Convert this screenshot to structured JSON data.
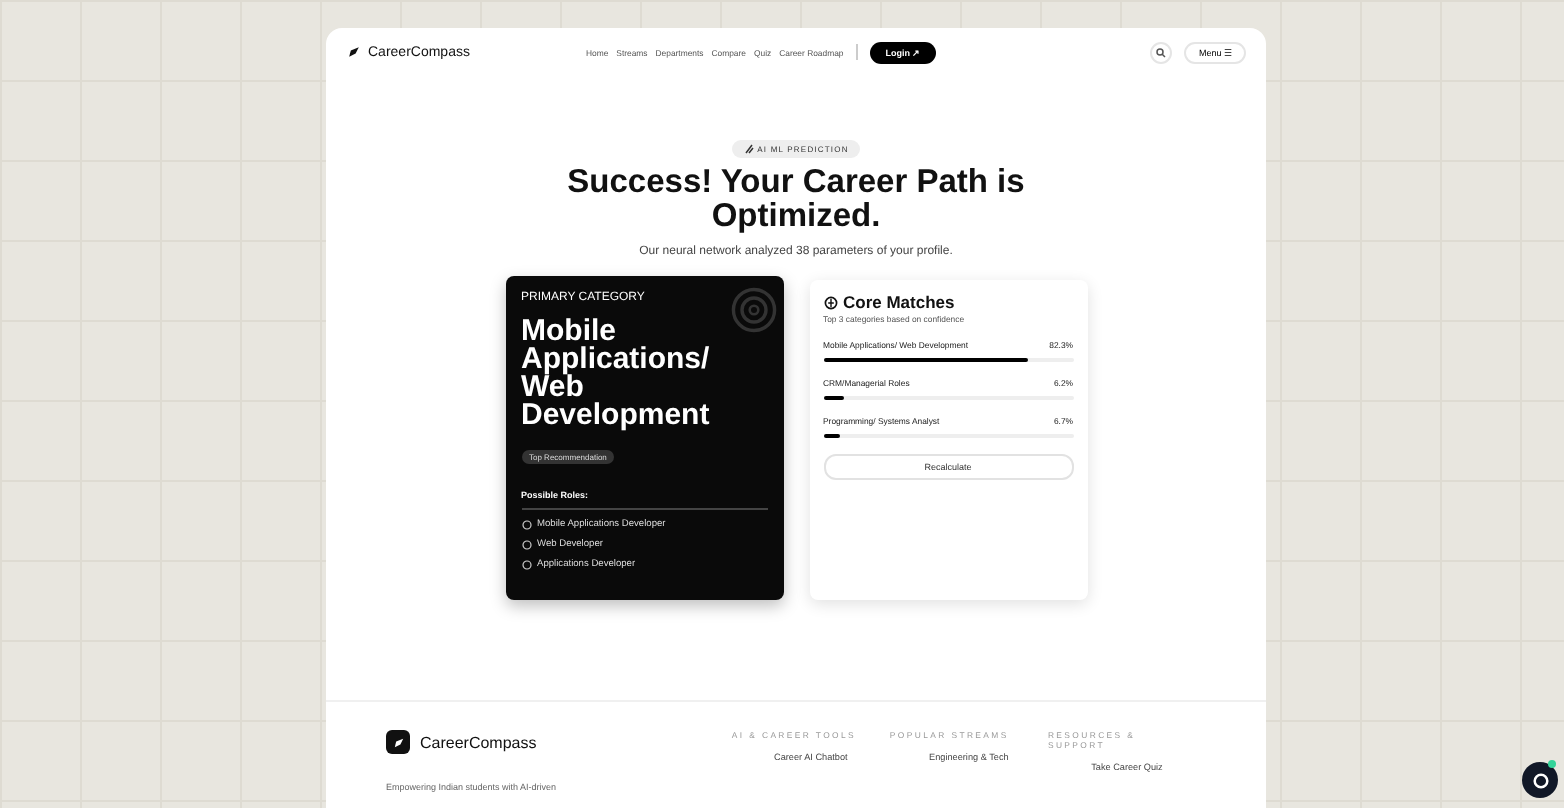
{
  "brand": "CareerCompass",
  "nav": {
    "links": [
      "Home",
      "Streams",
      "Departments",
      "Compare",
      "Quiz",
      "Career Roadmap"
    ],
    "login": "Login",
    "login_icon": "↗",
    "menu": "Menu",
    "menu_icon": "☰"
  },
  "hero": {
    "badge": "AI ML PREDICTION",
    "title": "Success! Your Career Path is Optimized.",
    "subtitle": "Our neural network analyzed 38 parameters of your profile."
  },
  "primary": {
    "label": "PRIMARY CATEGORY",
    "category": "Mobile Applications/ Web Development",
    "tag": "Top Recommendation",
    "roles_title": "Possible Roles:",
    "roles": [
      "Mobile Applications Developer",
      "Web Developer",
      "Applications Developer"
    ]
  },
  "matches": {
    "title": "Core Matches",
    "subtitle": "Top 3 categories based on confidence",
    "items": [
      {
        "name": "Mobile Applications/ Web Development",
        "reading": "82.3%",
        "level": 0.82
      },
      {
        "name": "CRM/Managerial Roles",
        "reading": "6.2%",
        "level": 0.08
      },
      {
        "name": "Programming/ Systems Analyst",
        "reading": "6.7%",
        "level": 0.07
      }
    ],
    "button": "Recalculate"
  },
  "footer": {
    "brand": "CareerCompass",
    "tagline": "Empowering Indian students with AI-driven",
    "columns": [
      {
        "title": "AI & CAREER TOOLS",
        "links": [
          "Career AI Chatbot"
        ]
      },
      {
        "title": "POPULAR STREAMS",
        "links": [
          "Engineering & Tech"
        ]
      },
      {
        "title": "RESOURCES & SUPPORT",
        "links": [
          "Take Career Quiz"
        ]
      }
    ]
  }
}
